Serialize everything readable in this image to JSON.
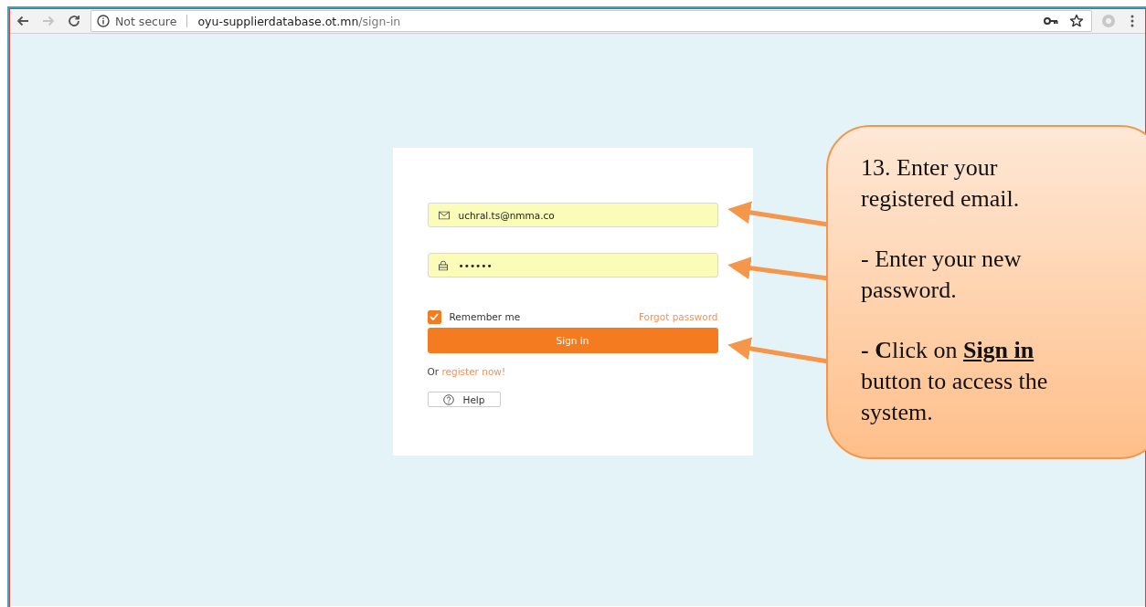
{
  "browser": {
    "nav_buttons": [
      {
        "kind": "back",
        "disabled": false
      },
      {
        "kind": "forward",
        "disabled": true
      },
      {
        "kind": "reload",
        "disabled": false
      }
    ],
    "address_bar": {
      "security": "Not secure",
      "url_host": "oyu-supplierdatabase.ot.mn",
      "url_path": "/sign-in"
    }
  },
  "login_form": {
    "email": {
      "value": "uchral.ts@nmma.co"
    },
    "password": {
      "value": "••••••"
    },
    "remember_me": {
      "label": "Remember me",
      "checked": true
    },
    "forgot_password": "Forgot password",
    "sign_in_button": "Sign in",
    "register_prefix": "Or",
    "register_link": "register now!",
    "help_button": "Help"
  },
  "callout": {
    "paragraphs": [
      "13. Enter your registered email.",
      "- Enter your new password.",
      "**- C**lick on **Sign in** button to access the system."
    ]
  }
}
